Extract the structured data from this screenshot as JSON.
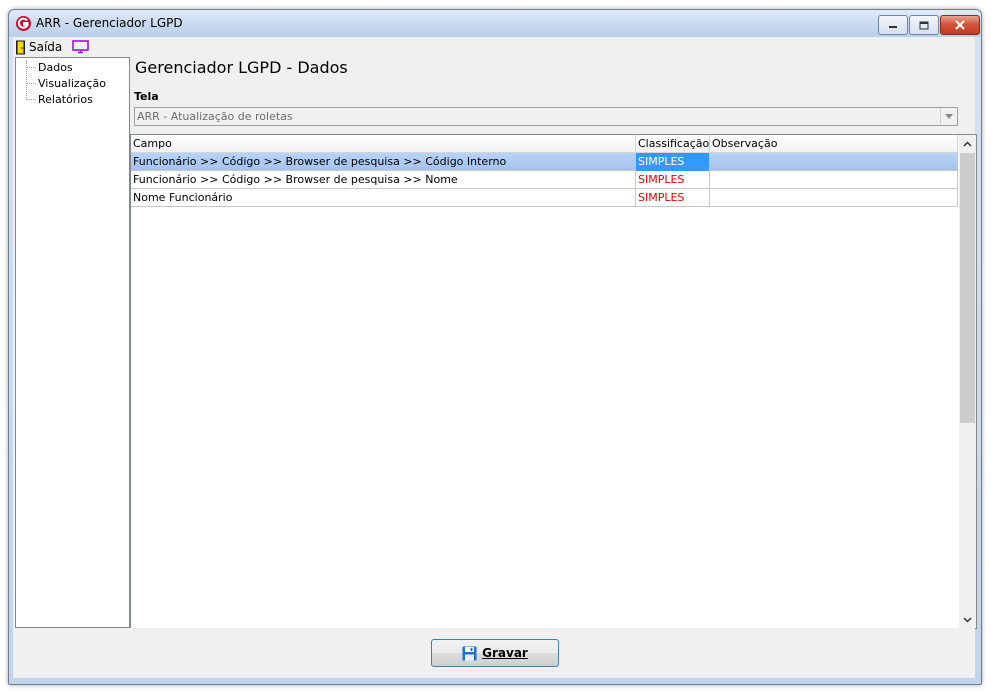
{
  "window": {
    "title": "ARR - Gerenciador LGPD",
    "controls": [
      "minimize-icon",
      "maximize-icon",
      "close-icon"
    ]
  },
  "menubar": {
    "exit_label": "Saída",
    "exit_icon": "door-exit-icon",
    "monitor_icon": "monitor-icon"
  },
  "sidebar": {
    "items": [
      {
        "label": "Dados"
      },
      {
        "label": "Visualização"
      },
      {
        "label": "Relatórios"
      }
    ]
  },
  "main": {
    "title": "Gerenciador LGPD - Dados",
    "screen_label": "Tela",
    "screen_value": "ARR - Atualização de roletas"
  },
  "grid": {
    "columns": [
      "Campo",
      "Classificação",
      "Observação"
    ],
    "rows": [
      {
        "campo": "Funcionário >> Código >> Browser de pesquisa >> Código Interno",
        "classificacao": "SIMPLES",
        "observacao": "",
        "selected": true
      },
      {
        "campo": "Funcionário >> Código >> Browser de pesquisa >> Nome",
        "classificacao": "SIMPLES",
        "observacao": "",
        "selected": false
      },
      {
        "campo": "Nome Funcionário",
        "classificacao": "SIMPLES",
        "observacao": "",
        "selected": false
      }
    ]
  },
  "footer": {
    "save_label": "Gravar",
    "save_icon": "floppy-disk-icon"
  },
  "colors": {
    "selection": "#3399ff",
    "classification_text": "#e00000",
    "row_highlight": "#b8d4f8"
  }
}
